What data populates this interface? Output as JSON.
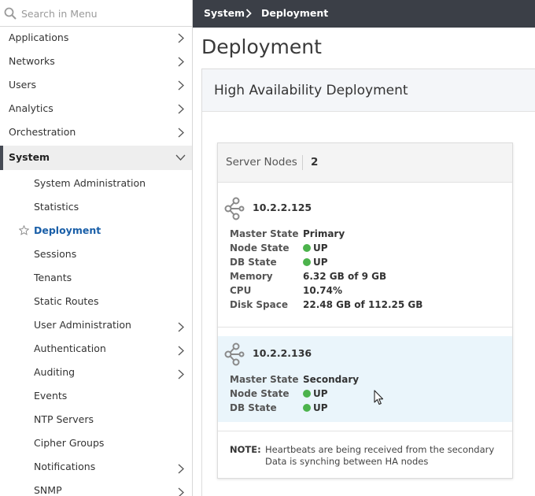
{
  "sidebar": {
    "search_placeholder": "Search in Menu",
    "items": [
      {
        "label": "Applications"
      },
      {
        "label": "Networks"
      },
      {
        "label": "Users"
      },
      {
        "label": "Analytics"
      },
      {
        "label": "Orchestration"
      },
      {
        "label": "System"
      }
    ],
    "sub_items": [
      {
        "label": "System Administration"
      },
      {
        "label": "Statistics"
      },
      {
        "label": "Deployment"
      },
      {
        "label": "Sessions"
      },
      {
        "label": "Tenants"
      },
      {
        "label": "Static Routes"
      },
      {
        "label": "User Administration"
      },
      {
        "label": "Authentication"
      },
      {
        "label": "Auditing"
      },
      {
        "label": "Events"
      },
      {
        "label": "NTP Servers"
      },
      {
        "label": "Cipher Groups"
      },
      {
        "label": "Notifications"
      },
      {
        "label": "SNMP"
      }
    ]
  },
  "breadcrumb": {
    "parent": "System",
    "current": "Deployment"
  },
  "page": {
    "title": "Deployment"
  },
  "panel": {
    "title": "High Availability Deployment"
  },
  "card": {
    "title": "Server Nodes",
    "count": "2",
    "nodes": [
      {
        "ip": "10.2.2.125",
        "master_state_label": "Master State",
        "master_state": "Primary",
        "node_state_label": "Node State",
        "node_state": "UP",
        "db_state_label": "DB State",
        "db_state": "UP",
        "memory_label": "Memory",
        "memory": "6.32 GB of 9 GB",
        "cpu_label": "CPU",
        "cpu": "10.74%",
        "disk_label": "Disk Space",
        "disk": "22.48 GB of 112.25 GB"
      },
      {
        "ip": "10.2.2.136",
        "master_state_label": "Master State",
        "master_state": "Secondary",
        "node_state_label": "Node State",
        "node_state": "UP",
        "db_state_label": "DB State",
        "db_state": "UP"
      }
    ],
    "note_label": "NOTE:",
    "note_line1": "Heartbeats are being received from the secondary",
    "note_line2": "Data is synching between HA nodes"
  },
  "colors": {
    "header_bg": "#3b3f47",
    "active_link": "#1a5fa8",
    "status_up": "#4cb34c",
    "selected_row_bg": "#eaf5fb"
  },
  "icons": [
    "search-icon",
    "chevron-right-icon",
    "chevron-down-icon",
    "star-icon",
    "share-nodes-icon",
    "mouse-cursor-icon"
  ]
}
